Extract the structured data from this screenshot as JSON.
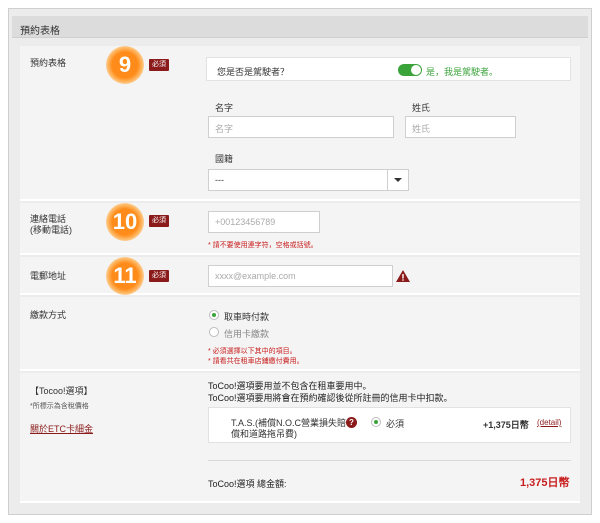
{
  "header": {
    "title": "預約表格"
  },
  "sections": {
    "driver": {
      "label": "預約表格",
      "badge": "9",
      "required": "必須",
      "question": "您是否是駕駛者？",
      "toggle_label": "是，我是駕駛者。",
      "first_name_label": "名字",
      "first_name_placeholder": "名字",
      "last_name_label": "姓氏",
      "last_name_placeholder": "姓氏",
      "nationality_label": "國籍",
      "nationality_value": "---"
    },
    "phone": {
      "label_line1": "連絡電話",
      "label_line2": "(移動電話)",
      "badge": "10",
      "required": "必須",
      "placeholder": "+00123456789",
      "note": "* 請不要使用連字符，空格或括號。"
    },
    "email": {
      "label": "電郵地址",
      "badge": "11",
      "required": "必須",
      "placeholder": "xxxx@example.com"
    },
    "payment": {
      "label": "繳款方式",
      "option1": "取車時付款",
      "option2": "信用卡繳款",
      "note1": "* 必須選擇以下其中的項目。",
      "note2": "* 請看共在租車店鋪繳付費用。"
    },
    "tocoo": {
      "label": "【Tocoo!選項】",
      "sub_label": "*所標示為含稅價格",
      "link": "關於ETC卡細金",
      "desc1": "ToCoo!選項要用並不包含在租車要用中。",
      "desc2": "ToCoo!選項要用將會在預約確認後從所註冊的信用卡中扣款。",
      "item_line1": "T.A.S.(補償N.O.C營業損失賠",
      "item_line2": "償和道路拖吊費)",
      "item_required": "必須",
      "item_price": "+1,375日幣",
      "item_detail": "(detail)",
      "total_label": "ToCoo!選項 總金額:",
      "total_value": "1,375日幣"
    }
  },
  "colors": {
    "accent_green": "#3aa33a",
    "badge_orange": "#ff8c1a",
    "required_red": "#8b1a1a",
    "price_red": "#c81d1d"
  }
}
